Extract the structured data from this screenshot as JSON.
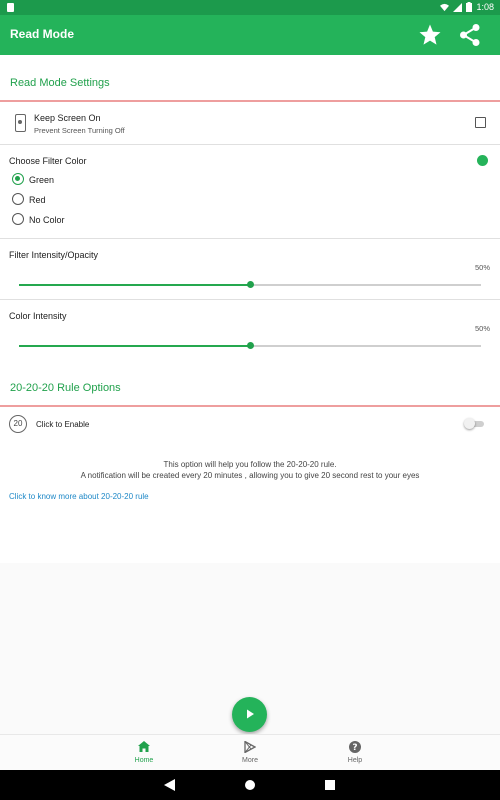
{
  "status_bar": {
    "time": "1:08"
  },
  "app_bar": {
    "title": "Read Mode"
  },
  "read_mode_section": {
    "title": "Read Mode Settings"
  },
  "keep_screen_on": {
    "label": "Keep Screen On",
    "sublabel": "Prevent Screen Turning Off",
    "checked": false
  },
  "filter_color": {
    "label": "Choose Filter Color",
    "indicator_color": "#25b35a",
    "options": [
      {
        "label": "Green",
        "selected": true
      },
      {
        "label": "Red",
        "selected": false
      },
      {
        "label": "No Color",
        "selected": false
      }
    ]
  },
  "filter_intensity": {
    "label": "Filter Intensity/Opacity",
    "percent_text": "50%",
    "value": 0.5
  },
  "color_intensity": {
    "label": "Color Intensity",
    "percent_text": "50%",
    "value": 0.5
  },
  "rule_section": {
    "title": "20-20-20 Rule Options",
    "badge": "20",
    "enable_label": "Click to Enable",
    "enabled": false,
    "info_line1": "This option will help you follow the 20-20-20 rule.",
    "info_line2": "A notification will be created every 20 minutes , allowing you to give 20 second rest to your eyes",
    "link_text": "Click to know more about 20-20-20 rule"
  },
  "bottom_nav": {
    "items": [
      {
        "label": "Home",
        "icon": "home-icon",
        "active": true
      },
      {
        "label": "More",
        "icon": "play-store-icon",
        "active": false
      },
      {
        "label": "Help",
        "icon": "help-icon",
        "active": false
      }
    ]
  },
  "colors": {
    "primary": "#24b35a",
    "primary_dark": "#1c9a4c",
    "accent_line": "#ee9e9e",
    "link": "#1e88c7"
  }
}
